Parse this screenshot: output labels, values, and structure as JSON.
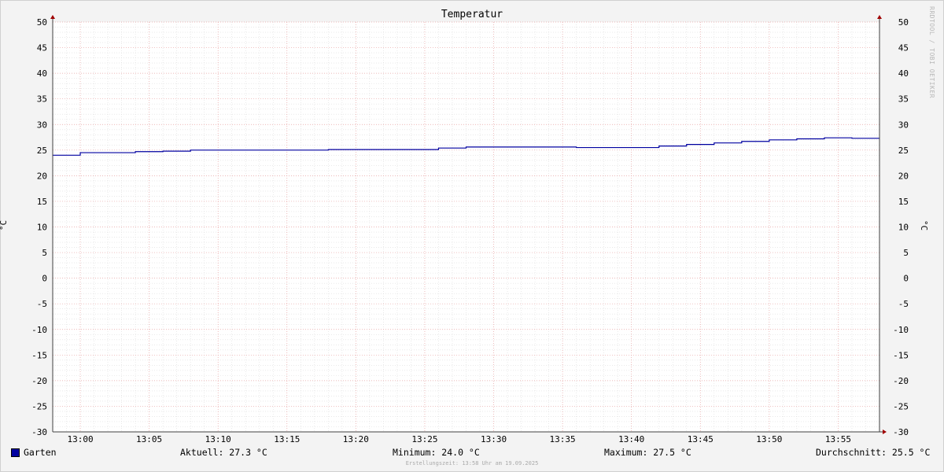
{
  "chart_data": {
    "type": "line",
    "title": "Temperatur",
    "ylabel": "°C",
    "ylim": [
      -30,
      50
    ],
    "yticks": [
      -30,
      -25,
      -20,
      -15,
      -10,
      -5,
      0,
      5,
      10,
      15,
      20,
      25,
      30,
      35,
      40,
      45,
      50
    ],
    "xrange": [
      "12:58",
      "13:58"
    ],
    "xticks": [
      "13:00",
      "13:05",
      "13:10",
      "13:15",
      "13:20",
      "13:25",
      "13:30",
      "13:35",
      "13:40",
      "13:45",
      "13:50",
      "13:55"
    ],
    "grid": true,
    "series": [
      {
        "name": "Garten",
        "color": "#0000a0",
        "step": true,
        "x": [
          "12:58",
          "13:00",
          "13:04",
          "13:06",
          "13:08",
          "13:18",
          "13:26",
          "13:28",
          "13:36",
          "13:42",
          "13:44",
          "13:46",
          "13:48",
          "13:50",
          "13:52",
          "13:54",
          "13:56",
          "13:58"
        ],
        "values": [
          24.0,
          24.5,
          24.7,
          24.8,
          25.0,
          25.1,
          25.4,
          25.6,
          25.5,
          25.8,
          26.1,
          26.4,
          26.7,
          27.0,
          27.2,
          27.4,
          27.3,
          27.3
        ]
      }
    ]
  },
  "header": {
    "title": "Temperatur",
    "watermark": "RRDTOOL / TOBI OETIKER"
  },
  "axis": {
    "left_label": "°C",
    "right_label": "°C"
  },
  "legend": {
    "series_name": "Garten",
    "swatch_color": "#0000a0",
    "current": "Aktuell: 27.3 °C",
    "minimum": "Minimum: 24.0 °C",
    "maximum": "Maximum: 27.5 °C",
    "average": "Durchschnitt: 25.5 °C"
  },
  "footer": {
    "created": "Erstellungszeit: 13:58 Uhr am 19.09.2025"
  }
}
